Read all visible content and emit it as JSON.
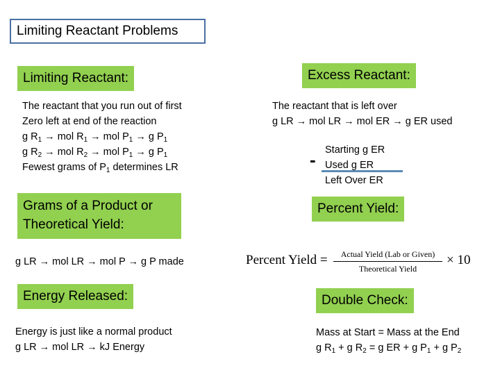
{
  "title": "Limiting Reactant Problems",
  "sections": {
    "limiting": {
      "header": "Limiting Reactant:",
      "line1": "The reactant that you run out of first",
      "line2": "Zero left at end of the reaction",
      "path1": [
        "g R",
        "1",
        " → mol R",
        "1",
        " → mol P",
        "1",
        " → g P",
        "1"
      ],
      "path2": [
        "g R",
        "2",
        " → mol R",
        "2",
        " → mol P",
        "1",
        " → g P",
        "1"
      ],
      "line5": [
        "Fewest grams of P",
        "1",
        " determines LR"
      ]
    },
    "excess": {
      "header": "Excess Reactant:",
      "line1": "The reactant that is left over",
      "line2": "g LR → mol LR → mol ER → g ER used",
      "minus_sign": "-",
      "calc_top": "Starting g ER",
      "calc_mid": "Used g ER",
      "calc_result": "Left Over ER"
    },
    "theoretical": {
      "header_line1": "Grams of a Product or",
      "header_line2": "Theoretical Yield:",
      "path": "g LR → mol LR → mol P → g P made"
    },
    "percent": {
      "header": "Percent Yield:",
      "formula_lhs": "Percent Yield =",
      "numerator": "Actual Yield (Lab or Given)",
      "denominator": "Theoretical Yield",
      "multiplier": "× 10"
    },
    "energy": {
      "header": "Energy Released:",
      "line1": "Energy is just like a normal product",
      "line2": "g LR → mol LR → kJ Energy"
    },
    "double_check": {
      "header": "Double Check:",
      "line1": "Mass at Start = Mass at the End",
      "line2": [
        "g R",
        "1",
        " + g R",
        "2",
        " = g ER + g P",
        "1",
        " + g P",
        "2"
      ]
    }
  },
  "colors": {
    "header_bg": "#92d050",
    "title_border": "#4a6fa5",
    "rule": "#5b8bb5"
  }
}
